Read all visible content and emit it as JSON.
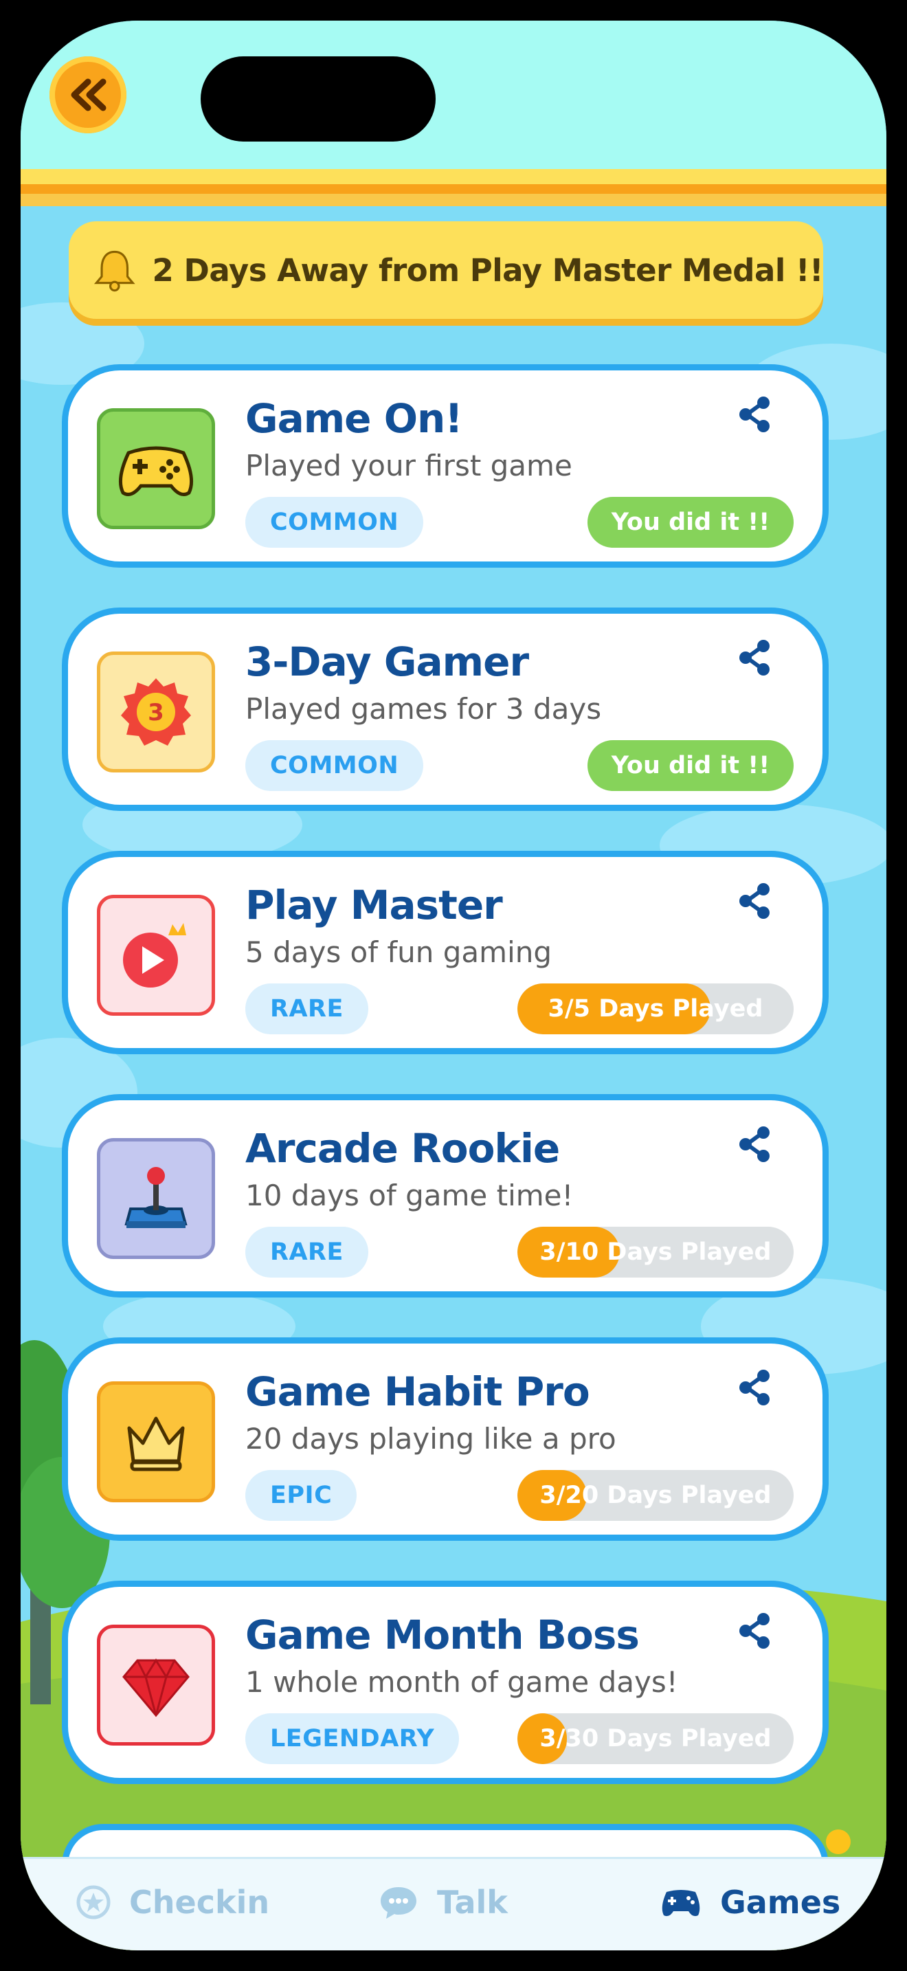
{
  "header": {
    "back_icon": "double-chevron-left-icon"
  },
  "banner": {
    "icon": "bell-icon",
    "text": "2 Days Away from Play Master Medal !!"
  },
  "achievements": [
    {
      "title": "Game On!",
      "description": "Played your first game",
      "rarity": "COMMON",
      "status": "You did it !!",
      "icon": "gamepad-icon",
      "completed": true
    },
    {
      "title": "3-Day Gamer",
      "description": "Played games for 3 days",
      "rarity": "COMMON",
      "status": "You did it !!",
      "icon": "badge-3-icon",
      "completed": true
    },
    {
      "title": "Play Master",
      "description": "5 days of fun gaming",
      "rarity": "RARE",
      "progress_text": "3/5 Days Played",
      "progress": 0.7,
      "icon": "play-crown-icon"
    },
    {
      "title": "Arcade Rookie",
      "description": "10 days of game time!",
      "rarity": "RARE",
      "progress_text": "3/10 Days Played",
      "progress": 0.37,
      "icon": "joystick-icon"
    },
    {
      "title": "Game Habit Pro",
      "description": "20 days playing like a pro",
      "rarity": "EPIC",
      "progress_text": "3/20 Days Played",
      "progress": 0.25,
      "icon": "crown-icon"
    },
    {
      "title": "Game Month Boss",
      "description": "1 whole month of game days!",
      "rarity": "LEGENDARY",
      "progress_text": "3/30 Days Played",
      "progress": 0.15,
      "icon": "gem-icon"
    }
  ],
  "tabs": [
    {
      "label": "Checkin",
      "icon": "star-badge-icon",
      "active": false
    },
    {
      "label": "Talk",
      "icon": "chat-bubble-icon",
      "active": false
    },
    {
      "label": "Games",
      "icon": "gamepad-icon",
      "active": true
    }
  ],
  "colors": {
    "card_border": "#2aa8ee",
    "title": "#124f96",
    "done": "#86d35a",
    "progress": "#f9a30f",
    "active_tab": "#124f96",
    "inactive_tab": "#9fc6e0"
  }
}
